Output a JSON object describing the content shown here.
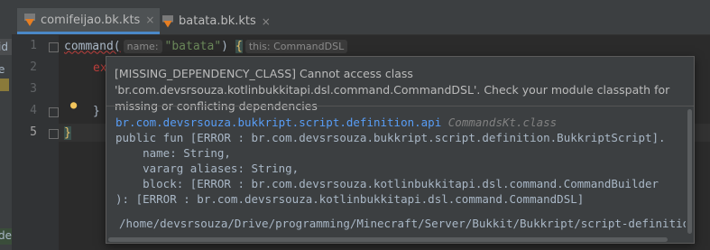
{
  "left_panel": {
    "items": [
      "id",
      "e",
      "",
      "",
      "",
      "",
      "",
      "",
      "",
      "",
      "dec",
      "e"
    ]
  },
  "tabs": [
    {
      "label": "comifeijao.bk.kts",
      "active": true,
      "icon": "kotlin-script-icon"
    },
    {
      "label": "batata.bk.kts",
      "active": false,
      "icon": "kotlin-script-icon"
    }
  ],
  "tab_close_glyph": "×",
  "gutter": {
    "line_numbers": [
      "1",
      "2",
      "3",
      "4",
      "5"
    ],
    "current_line": "5"
  },
  "code": {
    "line1": {
      "call": "command(",
      "param_hint": "name:",
      "arg": "\"batata\"",
      "close_paren": ")",
      "brace": "{",
      "type_hint": "this: CommandDSL"
    },
    "line2": {
      "text": "ex"
    },
    "line4": {
      "text": "}"
    },
    "line5": {
      "text": "}"
    }
  },
  "popup": {
    "message": "[MISSING_DEPENDENCY_CLASS] Cannot access class 'br.com.devsrsouza.kotlinbukkitapi.dsl.command.CommandDSL'. Check your module classpath for missing or conflicting dependencies",
    "doc": {
      "package": "br.com.devsrsouza.bukkript.script.definition.api",
      "class_file": "CommandsKt.class",
      "lines": [
        "public fun [ERROR : br.com.devsrsouza.bukkript.script.definition.BukkriptScript].",
        "    name: String,",
        "    vararg aliases: String,",
        "    block: [ERROR : br.com.devsrsouza.kotlinbukkitapi.dsl.command.CommandBuilder",
        "): [ERROR : br.com.devsrsouza.kotlinbukkitapi.dsl.command.CommandDSL]"
      ]
    },
    "path": "/home/devsrsouza/Drive/programming/Minecraft/Server/Bukkit/Bukkript/script-definition/build/lib"
  },
  "colors": {
    "string": "#6a8759",
    "package_link": "#589df6",
    "accent_tab": "#4a88c7",
    "error_underline": "#bc3f3c"
  }
}
